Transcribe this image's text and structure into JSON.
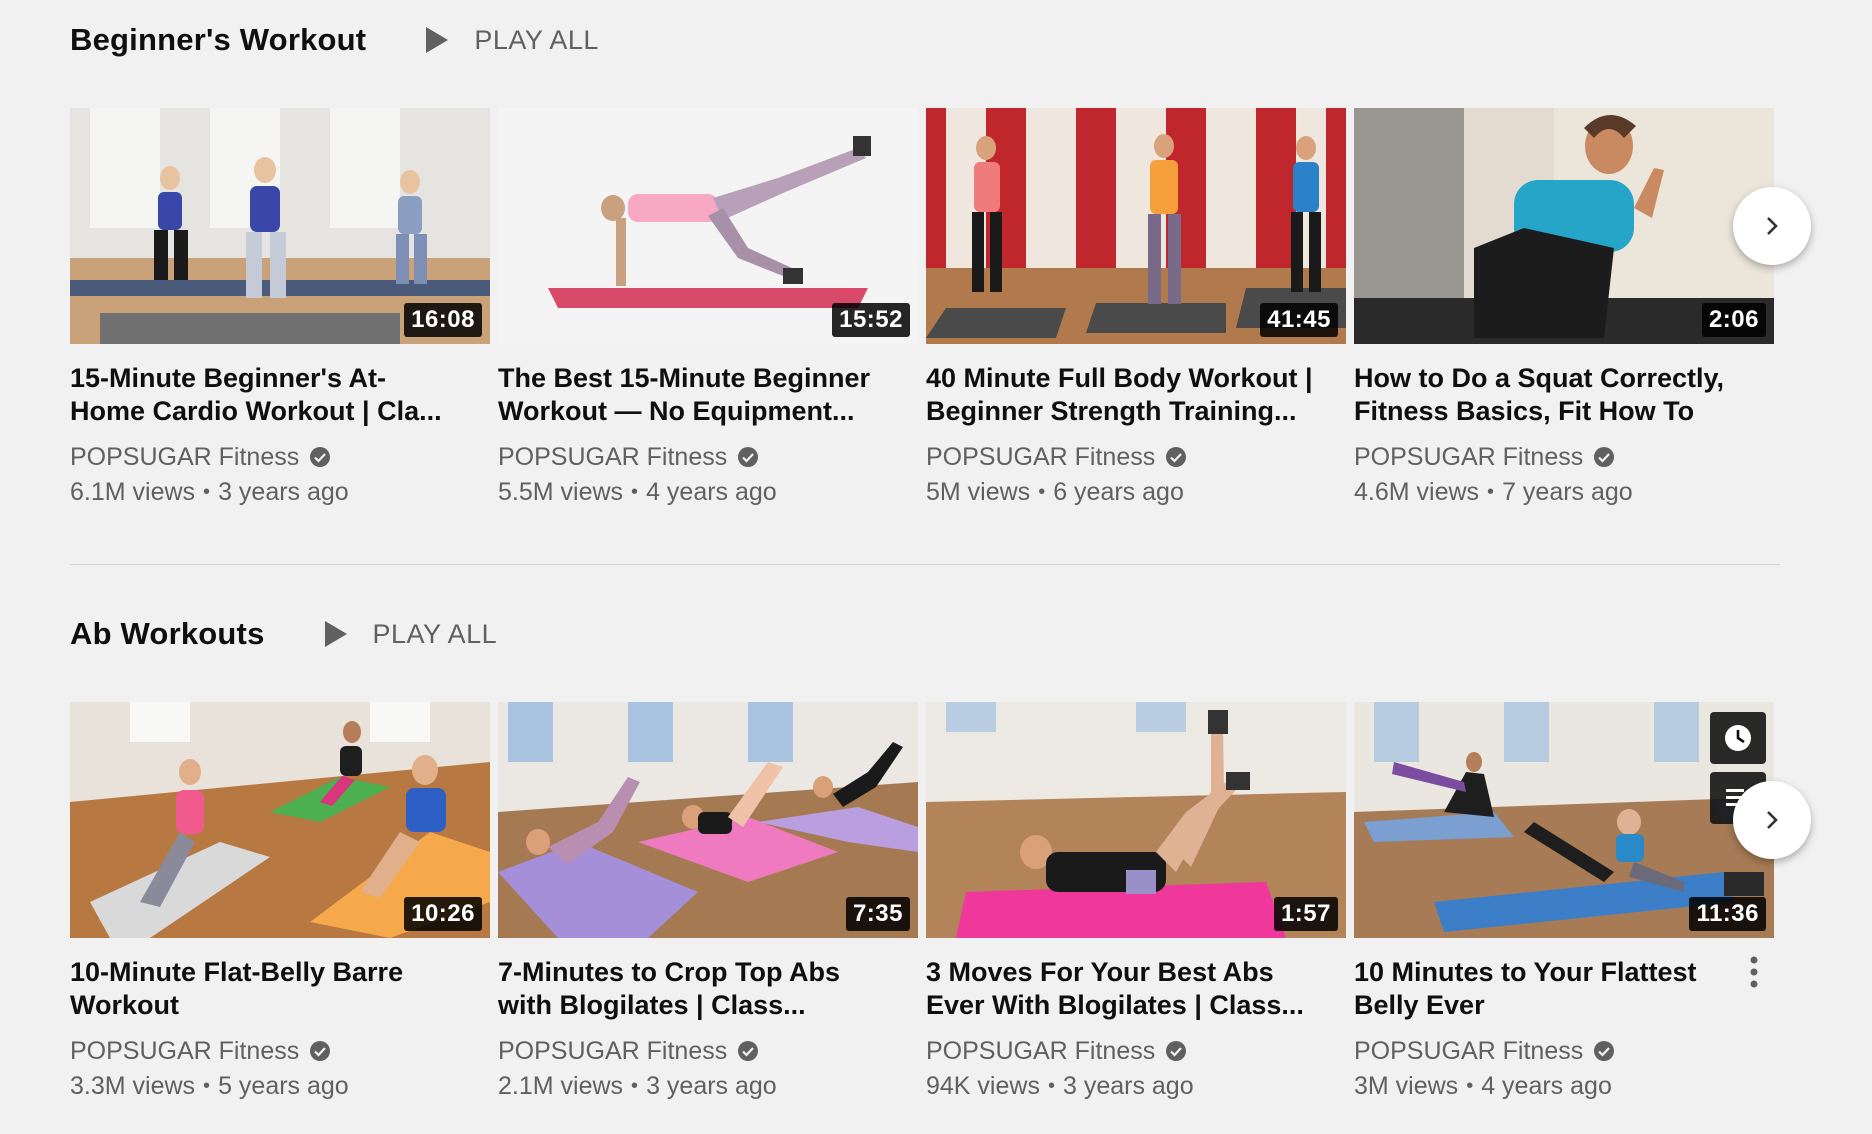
{
  "shelves": [
    {
      "title": "Beginner's Workout",
      "play_all": "PLAY ALL",
      "videos": [
        {
          "title": "15-Minute Beginner's At-Home Cardio Workout | Cla...",
          "duration": "16:08",
          "channel": "POPSUGAR Fitness",
          "views": "6.1M views",
          "age": "3 years ago"
        },
        {
          "title": "The Best 15-Minute Beginner Workout — No Equipment...",
          "duration": "15:52",
          "channel": "POPSUGAR Fitness",
          "views": "5.5M views",
          "age": "4 years ago"
        },
        {
          "title": "40 Minute Full Body Workout | Beginner Strength Training...",
          "duration": "41:45",
          "channel": "POPSUGAR Fitness",
          "views": "5M views",
          "age": "6 years ago"
        },
        {
          "title": "How to Do a Squat Correctly, Fitness Basics, Fit How To",
          "duration": "2:06",
          "channel": "POPSUGAR Fitness",
          "views": "4.6M views",
          "age": "7 years ago"
        }
      ]
    },
    {
      "title": "Ab Workouts",
      "play_all": "PLAY ALL",
      "videos": [
        {
          "title": "10-Minute Flat-Belly Barre Workout",
          "duration": "10:26",
          "channel": "POPSUGAR Fitness",
          "views": "3.3M views",
          "age": "5 years ago"
        },
        {
          "title": "7-Minutes to Crop Top Abs with Blogilates | Class...",
          "duration": "7:35",
          "channel": "POPSUGAR Fitness",
          "views": "2.1M views",
          "age": "3 years ago"
        },
        {
          "title": "3 Moves For Your Best Abs Ever With Blogilates | Class...",
          "duration": "1:57",
          "channel": "POPSUGAR Fitness",
          "views": "94K views",
          "age": "3 years ago"
        },
        {
          "title": "10 Minutes to Your Flattest Belly Ever",
          "duration": "11:36",
          "channel": "POPSUGAR Fitness",
          "views": "3M views",
          "age": "4 years ago"
        }
      ]
    }
  ],
  "separator": "•",
  "icons": {
    "play": "play-icon",
    "verified": "verified-check-icon",
    "next": "chevron-right-icon",
    "watch_later": "clock-icon",
    "add_to_queue": "queue-icon",
    "more": "more-vert-icon"
  },
  "colors": {
    "background": "#f1f1f1",
    "title_text": "#0f0f0f",
    "secondary_text": "#606060",
    "duration_bg": "#000000"
  }
}
